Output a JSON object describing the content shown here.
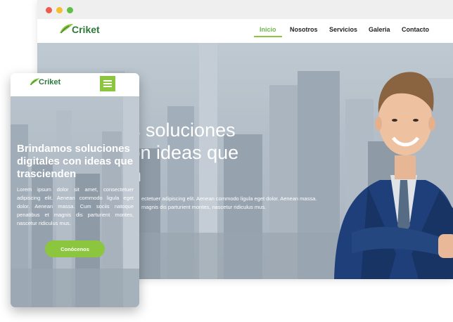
{
  "brand": {
    "name": "Criket",
    "green": "#8cc63f",
    "dark_green": "#2d7a3a"
  },
  "window": {
    "dots": [
      "close",
      "minimize",
      "maximize"
    ]
  },
  "desktop": {
    "nav": [
      {
        "label": "Inicio",
        "active": true
      },
      {
        "label": "Nosotros"
      },
      {
        "label": "Servicios"
      },
      {
        "label": "Galeria"
      },
      {
        "label": "Contacto"
      }
    ],
    "hero_title": "os soluciones\ncon ideas que\nen",
    "hero_text": "ectetuer adipiscing elit. Aenean commodo ligula eget dolor. Aenean massa. magnis dis parturient montes, nascetur ridiculus mus."
  },
  "mobile": {
    "title": "Brindamos soluciones\ndigitales con ideas que\ntrascienden",
    "text": "Lorem ipsum dolor sit amet, consectetuer adipiscing elit. Aenean commodo ligula eget dolor. Aenean massa. Cum sociis natoque penatibus et magnis dis parturient montes, nascetur ridiculus mus.",
    "cta": "Conócenos",
    "menu_icon": "hamburger-icon"
  }
}
